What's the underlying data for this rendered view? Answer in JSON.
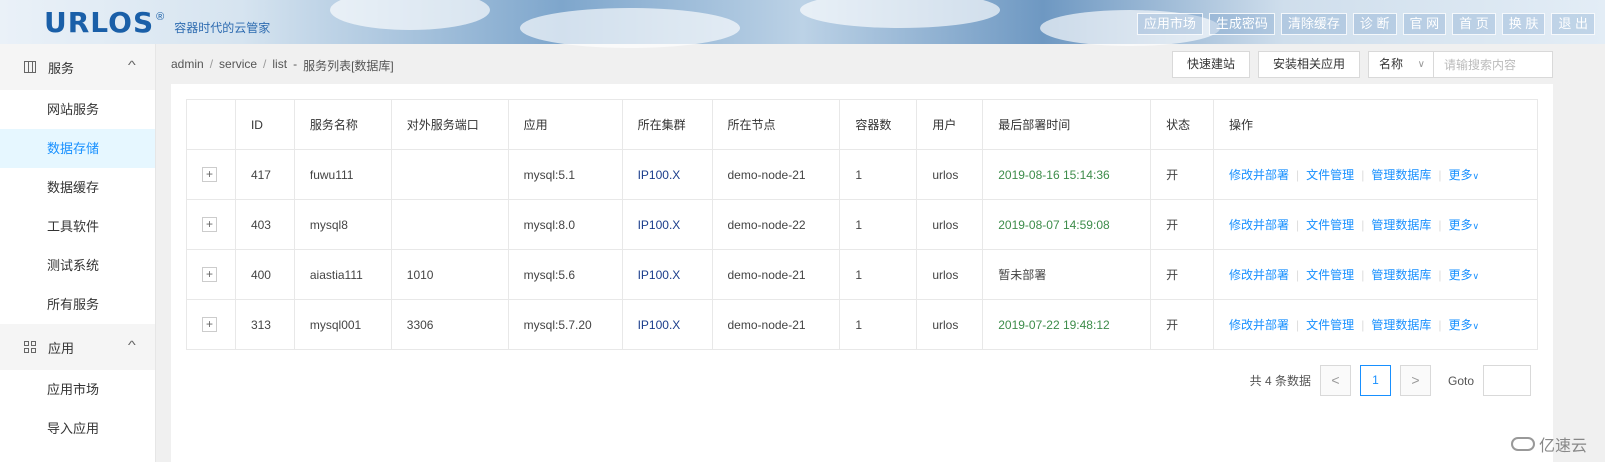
{
  "header": {
    "logo_text": "URLOS",
    "logo_reg": "®",
    "slogan": "容器时代的云管家",
    "nav": [
      "应用市场",
      "生成密码",
      "清除缓存",
      "诊 断",
      "官 网",
      "首 页",
      "换 肤",
      "退 出"
    ]
  },
  "sidebar": {
    "groups": [
      {
        "label": "服务",
        "icon": "server-icon",
        "expanded": true,
        "items": [
          "网站服务",
          "数据存储",
          "数据缓存",
          "工具软件",
          "测试系统",
          "所有服务"
        ]
      },
      {
        "label": "应用",
        "icon": "grid-icon",
        "expanded": true,
        "items": [
          "应用市场",
          "导入应用"
        ]
      }
    ],
    "active_item": "数据存储"
  },
  "breadcrumb": {
    "parts": [
      "admin",
      "service",
      "list"
    ],
    "separator": "/",
    "title": "服务列表[数据库]",
    "title_separator": "-"
  },
  "toolbar": {
    "quick_build": "快速建站",
    "install_app": "安装相关应用",
    "search_field": "名称",
    "search_placeholder": "请输搜索内容"
  },
  "table": {
    "columns": [
      "",
      "ID",
      "服务名称",
      "对外服务端口",
      "应用",
      "所在集群",
      "所在节点",
      "容器数",
      "用户",
      "最后部署时间",
      "状态",
      "操作"
    ],
    "rows": [
      {
        "expand": "+",
        "id": "417",
        "name": "fuwu111",
        "port": "",
        "app": "mysql:5.1",
        "cluster": "IP100.X",
        "node": "demo-node-21",
        "containers": "1",
        "user": "urlos",
        "deploy_time": "2019-08-16 15:14:36",
        "deployed": true,
        "status": "开"
      },
      {
        "expand": "+",
        "id": "403",
        "name": "mysql8",
        "port": "",
        "app": "mysql:8.0",
        "cluster": "IP100.X",
        "node": "demo-node-22",
        "containers": "1",
        "user": "urlos",
        "deploy_time": "2019-08-07 14:59:08",
        "deployed": true,
        "status": "开"
      },
      {
        "expand": "+",
        "id": "400",
        "name": "aiastia111",
        "port": "1010",
        "app": "mysql:5.6",
        "cluster": "IP100.X",
        "node": "demo-node-21",
        "containers": "1",
        "user": "urlos",
        "deploy_time": "暂未部署",
        "deployed": false,
        "status": "开"
      },
      {
        "expand": "+",
        "id": "313",
        "name": "mysql001",
        "port": "3306",
        "app": "mysql:5.7.20",
        "cluster": "IP100.X",
        "node": "demo-node-21",
        "containers": "1",
        "user": "urlos",
        "deploy_time": "2019-07-22 19:48:12",
        "deployed": true,
        "status": "开"
      }
    ],
    "actions": [
      "修改并部署",
      "文件管理",
      "管理数据库",
      "更多"
    ]
  },
  "pagination": {
    "total_text": "共 4 条数据",
    "prev": "<",
    "current": "1",
    "next": ">",
    "goto_label": "Goto"
  },
  "watermark": "亿速云",
  "colors": {
    "accent": "#1890ff",
    "logo": "#1a5fa8",
    "deploy_time": "#3d8c4a",
    "cluster": "#1a3d8c",
    "active_bg": "#e6f7ff"
  }
}
